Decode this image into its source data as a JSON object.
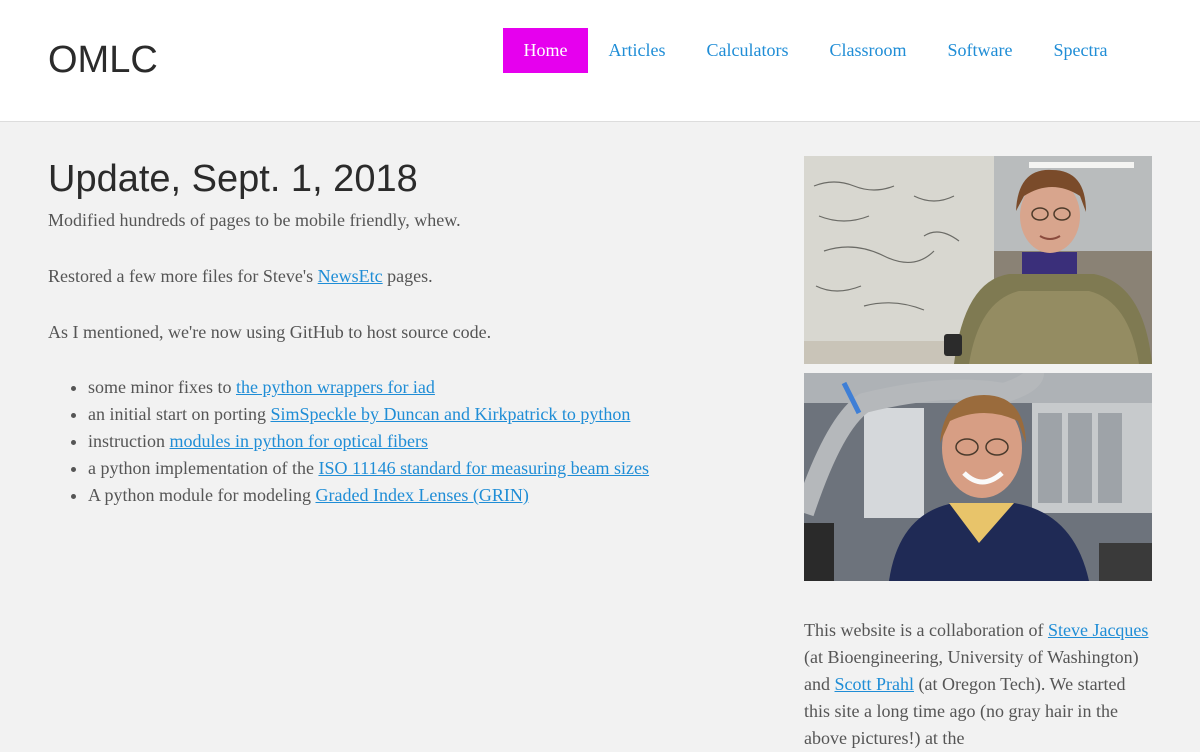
{
  "header": {
    "logo": "OMLC",
    "nav": [
      {
        "label": "Home",
        "active": true
      },
      {
        "label": "Articles",
        "active": false
      },
      {
        "label": "Calculators",
        "active": false
      },
      {
        "label": "Classroom",
        "active": false
      },
      {
        "label": "Software",
        "active": false
      },
      {
        "label": "Spectra",
        "active": false
      }
    ]
  },
  "main": {
    "title": "Update, Sept. 1, 2018",
    "p1": "Modified hundreds of pages to be mobile friendly, whew.",
    "p2": {
      "before": "Restored a few more files for Steve's ",
      "link": "NewsEtc",
      "after": " pages."
    },
    "p3": "As I mentioned, we're now using GitHub to host source code.",
    "list": [
      {
        "text": "some minor fixes to ",
        "link": "the python wrappers for iad"
      },
      {
        "text": "an initial start on porting ",
        "link": "SimSpeckle by Duncan and Kirkpatrick to python"
      },
      {
        "text": "instruction ",
        "link": "modules in python for optical fibers"
      },
      {
        "text": "a python implementation of the ",
        "link": "ISO 11146 standard for measuring beam sizes"
      },
      {
        "text": "A python module for modeling ",
        "link": "Graded Index Lenses (GRIN)"
      }
    ]
  },
  "sidebar": {
    "t1": "This website is a collaboration of ",
    "link1": "Steve Jacques",
    "t2": " (at Bioengineering, University of Washington) and ",
    "link2": "Scott Prahl",
    "t3": " (at Oregon Tech). We started this site a long time ago (no gray hair in the above pictures!) at the"
  },
  "colors": {
    "accent": "#e600ee",
    "link": "#1f8dd6",
    "background": "#f2f2f2"
  }
}
